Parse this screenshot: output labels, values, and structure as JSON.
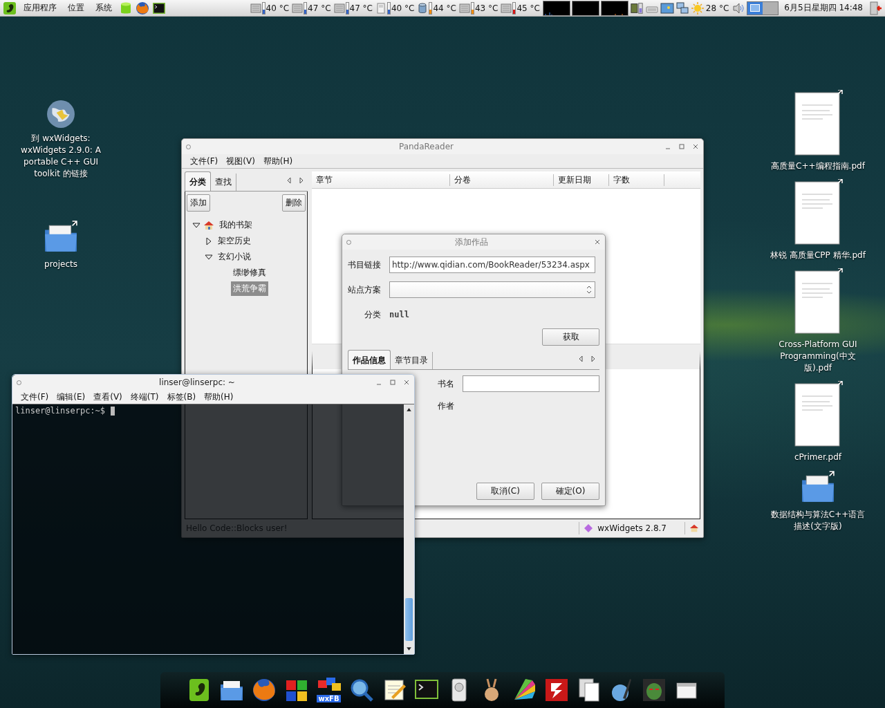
{
  "top_panel": {
    "menus": [
      "应用程序",
      "位置",
      "系统"
    ],
    "sensors": [
      {
        "kind": "disk",
        "reading": "40 °C",
        "color": "#3465c8"
      },
      {
        "kind": "disk",
        "reading": "47 °C",
        "color": "#3465c8"
      },
      {
        "kind": "disk",
        "reading": "47 °C",
        "color": "#3465c8"
      },
      {
        "kind": "drive",
        "reading": "40 °C",
        "color": "#3465c8"
      },
      {
        "kind": "cylinder",
        "reading": "44 °C",
        "color": "#f08c10"
      },
      {
        "kind": "disk",
        "reading": "43 °C",
        "color": "#f08c10"
      },
      {
        "kind": "disk",
        "reading": "45 °C",
        "color": "#d81818"
      }
    ],
    "weather": "28 °C",
    "workspaces": [
      {
        "selected": true
      },
      {
        "selected": false
      }
    ],
    "clock": "6月5日星期四 14:48"
  },
  "desktop_left": [
    {
      "kind": "globe",
      "label": "到 wxWidgets: wxWidgets 2.9.0: A portable C++ GUI toolkit 的链接"
    },
    {
      "kind": "folder",
      "label": "projects"
    }
  ],
  "desktop_right": [
    {
      "kind": "document",
      "label": "高质量C++编程指南.pdf"
    },
    {
      "kind": "document",
      "label": "林锐 高质量CPP 精华.pdf"
    },
    {
      "kind": "document",
      "label": "Cross-Platform GUI Programming(中文版).pdf"
    },
    {
      "kind": "document",
      "label": "cPrimer.pdf"
    },
    {
      "kind": "folder",
      "label": "数据结构与算法C++语言描述(文字版)"
    }
  ],
  "panda_window": {
    "title": "PandaReader",
    "menu": [
      "文件(F)",
      "视图(V)",
      "帮助(H)"
    ],
    "side_tabs": [
      {
        "label": "分类",
        "selected": true
      },
      {
        "label": "查找",
        "selected": false
      }
    ],
    "add_button": "添加",
    "delete_button": "删除",
    "tree": [
      {
        "label": "我的书架",
        "expanded": true,
        "selected": false,
        "children": [
          {
            "label": "架空历史",
            "expanded": false,
            "selected": false
          },
          {
            "label": "玄幻小说",
            "expanded": true,
            "selected": false,
            "children": [
              {
                "label": "缥缈修真",
                "selected": false
              },
              {
                "label": "洪荒争霸",
                "selected": true
              }
            ]
          }
        ]
      }
    ],
    "columns": [
      "章节",
      "分卷",
      "更新日期",
      "字数"
    ],
    "status": {
      "message": "Hello Code::Blocks user!",
      "version": "wxWidgets 2.8.7"
    }
  },
  "dialog": {
    "title": "添加作品",
    "fields": [
      {
        "label": "书目链接",
        "kind": "text",
        "value": "http://www.qidian.com/BookReader/53234.aspx"
      },
      {
        "label": "站点方案",
        "kind": "combo"
      },
      {
        "label": "分类",
        "kind": "static",
        "value": "null"
      }
    ],
    "fetch_button": "获取",
    "tabs": [
      {
        "label": "作品信息",
        "selected": true
      },
      {
        "label": "章节目录",
        "selected": false
      }
    ],
    "info_fields": [
      {
        "label": "书名",
        "kind": "text"
      },
      {
        "label": "作者",
        "kind": "static"
      }
    ],
    "buttons": [
      "取消(C)",
      "確定(O)"
    ]
  },
  "terminal": {
    "title": "linser@linserpc: ~",
    "menu": [
      "文件(F)",
      "编辑(E)",
      "查看(V)",
      "终端(T)",
      "标签(B)",
      "帮助(H)"
    ],
    "prompt": "linser@linserpc:~$"
  },
  "dock": {
    "wxfb_label": "wxFB"
  }
}
